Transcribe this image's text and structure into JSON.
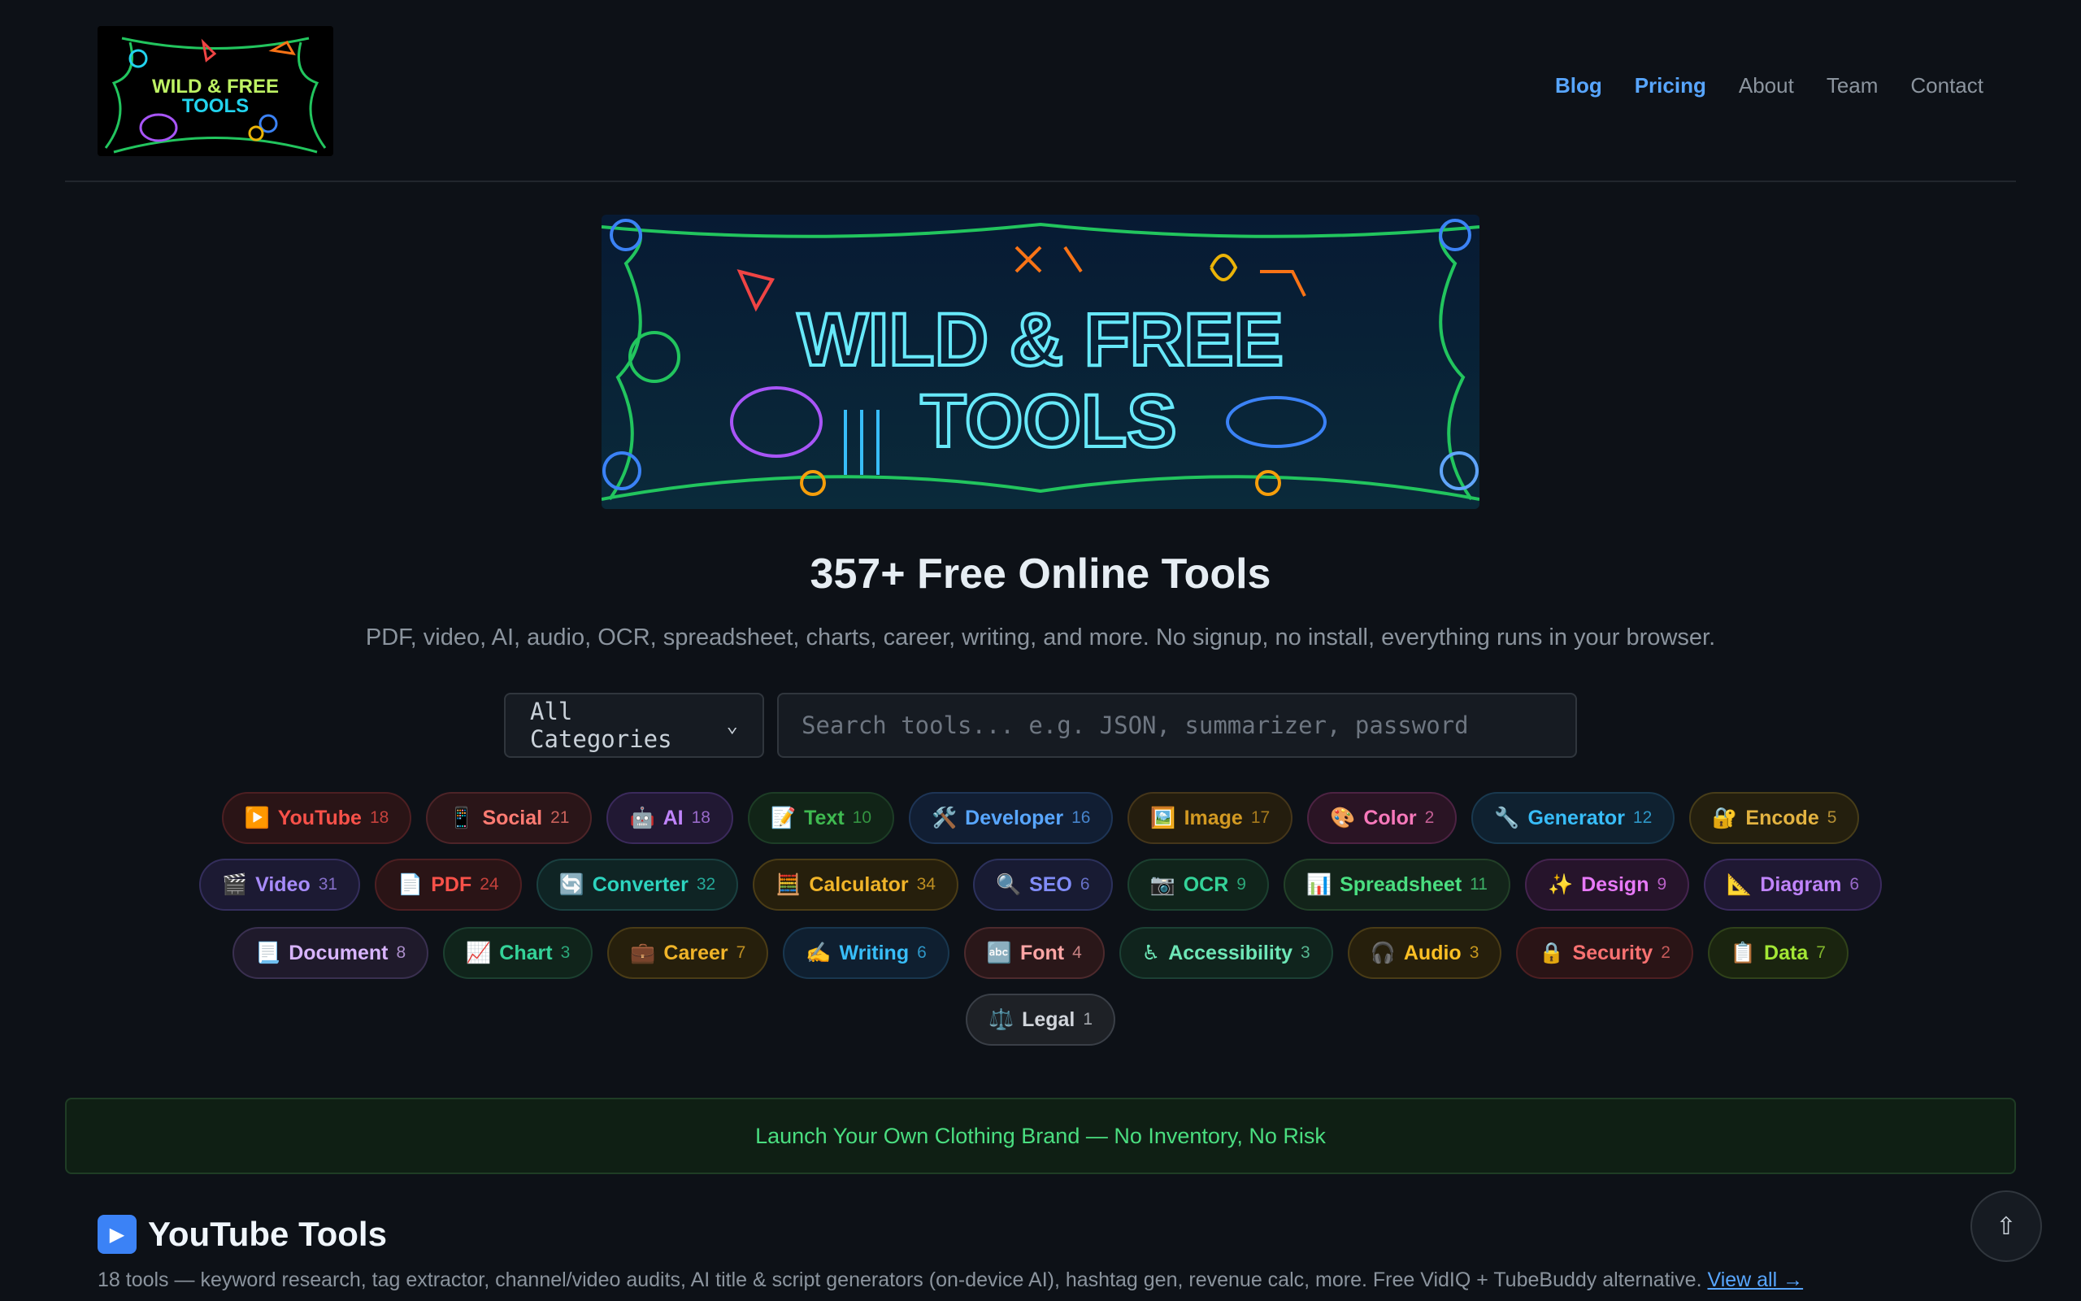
{
  "logo": {
    "text": "WILD & FREE TOOLS"
  },
  "nav": {
    "items": [
      {
        "label": "Blog",
        "active": true
      },
      {
        "label": "Pricing",
        "active": true
      },
      {
        "label": "About",
        "active": false
      },
      {
        "label": "Team",
        "active": false
      },
      {
        "label": "Contact",
        "active": false
      }
    ]
  },
  "banner": {
    "line1": "WILD & FREE",
    "line2": "TOOLS"
  },
  "hero": {
    "title": "357+ Free Online Tools",
    "subtitle": "PDF, video, AI, audio, OCR, spreadsheet, charts, career, writing, and more. No signup, no install, everything runs in your browser."
  },
  "search": {
    "category_value": "All Categories",
    "placeholder": "Search tools... e.g. JSON, summarizer, password"
  },
  "categories": [
    [
      {
        "icon": "▶️",
        "label": "YouTube",
        "count": "18",
        "color": "#f85149",
        "bg": "#2a1416",
        "border": "#4d1f22"
      },
      {
        "icon": "📱",
        "label": "Social",
        "count": "21",
        "color": "#ff7b72",
        "bg": "#2a1518",
        "border": "#4d2428"
      },
      {
        "icon": "🤖",
        "label": "AI",
        "count": "18",
        "color": "#c084fc",
        "bg": "#211833",
        "border": "#3b2a5c"
      },
      {
        "icon": "📝",
        "label": "Text",
        "count": "10",
        "color": "#3fb950",
        "bg": "#112417",
        "border": "#1d3d26"
      },
      {
        "icon": "🛠️",
        "label": "Developer",
        "count": "16",
        "color": "#58a6ff",
        "bg": "#111e33",
        "border": "#1e3556"
      },
      {
        "icon": "🖼️",
        "label": "Image",
        "count": "17",
        "color": "#d29922",
        "bg": "#241d0e",
        "border": "#45361a"
      },
      {
        "icon": "🎨",
        "label": "Color",
        "count": "2",
        "color": "#f778ba",
        "bg": "#2a1424",
        "border": "#4d2343"
      },
      {
        "icon": "🔧",
        "label": "Generator",
        "count": "12",
        "color": "#38bdf8",
        "bg": "#0f2130",
        "border": "#19394f"
      },
      {
        "icon": "🔐",
        "label": "Encode",
        "count": "5",
        "color": "#e3b341",
        "bg": "#241f0e",
        "border": "#473d19"
      }
    ],
    [
      {
        "icon": "🎬",
        "label": "Video",
        "count": "31",
        "color": "#a78bfa",
        "bg": "#1c1a33",
        "border": "#342e5c"
      },
      {
        "icon": "📄",
        "label": "PDF",
        "count": "24",
        "color": "#f85149",
        "bg": "#2a1416",
        "border": "#4d1f22"
      },
      {
        "icon": "🔄",
        "label": "Converter",
        "count": "32",
        "color": "#2dd4bf",
        "bg": "#0f2424",
        "border": "#1a4040"
      },
      {
        "icon": "🧮",
        "label": "Calculator",
        "count": "34",
        "color": "#f0b429",
        "bg": "#261f0c",
        "border": "#4a3c16"
      },
      {
        "icon": "🔍",
        "label": "SEO",
        "count": "6",
        "color": "#818cf8",
        "bg": "#181b33",
        "border": "#2c315c"
      },
      {
        "icon": "📷",
        "label": "OCR",
        "count": "9",
        "color": "#34d399",
        "bg": "#10241b",
        "border": "#1c4030"
      },
      {
        "icon": "📊",
        "label": "Spreadsheet",
        "count": "11",
        "color": "#4ade80",
        "bg": "#13241a",
        "border": "#224028"
      },
      {
        "icon": "✨",
        "label": "Design",
        "count": "9",
        "color": "#e879f9",
        "bg": "#26142b",
        "border": "#45244f"
      },
      {
        "icon": "📐",
        "label": "Diagram",
        "count": "6",
        "color": "#c084fc",
        "bg": "#1f1833",
        "border": "#3a2a5c"
      }
    ],
    [
      {
        "icon": "📃",
        "label": "Document",
        "count": "8",
        "color": "#d8b4fe",
        "bg": "#1f1a2b",
        "border": "#3a3050"
      },
      {
        "icon": "📈",
        "label": "Chart",
        "count": "3",
        "color": "#34d399",
        "bg": "#10241b",
        "border": "#1c4030"
      },
      {
        "icon": "💼",
        "label": "Career",
        "count": "7",
        "color": "#f0b429",
        "bg": "#261f0c",
        "border": "#4a3c16"
      },
      {
        "icon": "✍️",
        "label": "Writing",
        "count": "6",
        "color": "#38bdf8",
        "bg": "#0f1f30",
        "border": "#19374f"
      },
      {
        "icon": "🔤",
        "label": "Font",
        "count": "4",
        "color": "#fca5a5",
        "bg": "#2a1719",
        "border": "#4d2a2d"
      },
      {
        "icon": "♿",
        "label": "Accessibility",
        "count": "3",
        "color": "#6ee7b7",
        "bg": "#10241d",
        "border": "#1c4034"
      },
      {
        "icon": "🎧",
        "label": "Audio",
        "count": "3",
        "color": "#fbbf24",
        "bg": "#261f0c",
        "border": "#4a3c16"
      },
      {
        "icon": "🔒",
        "label": "Security",
        "count": "2",
        "color": "#f87171",
        "bg": "#2a1416",
        "border": "#4d1f22"
      },
      {
        "icon": "📋",
        "label": "Data",
        "count": "7",
        "color": "#a3e635",
        "bg": "#1a240f",
        "border": "#30421a"
      }
    ],
    [
      {
        "icon": "⚖️",
        "label": "Legal",
        "count": "1",
        "color": "#d1d5db",
        "bg": "#1e2126",
        "border": "#3a3f47"
      }
    ]
  ],
  "ad": {
    "text": "Launch Your Own Clothing Brand — No Inventory, No Risk"
  },
  "section": {
    "title": "YouTube Tools",
    "description": "18 tools — keyword research, tag extractor, channel/video audits, AI title & script generators (on-device AI), hashtag gen, revenue calc, more. Free VidIQ + TubeBuddy alternative.",
    "view_all": "View all →"
  },
  "scroll_top": {
    "icon": "⇧"
  }
}
